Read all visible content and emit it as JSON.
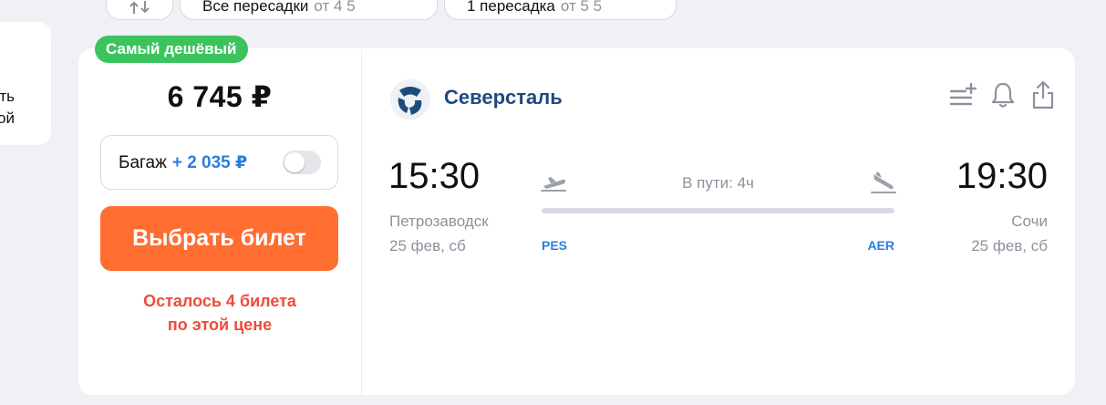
{
  "filters": {
    "sort_icon": "sort-arrows-icon",
    "all_transfers": {
      "label": "Все пересадки",
      "price": "от 4 5"
    },
    "one_transfer": {
      "label": "1 пересадка",
      "price": "от 5 5"
    }
  },
  "side_card": {
    "line1": "ть",
    "line2": "ой"
  },
  "ticket": {
    "badge": "Самый дешёвый",
    "price": "6 745 ₽",
    "baggage": {
      "label": "Багаж",
      "extra": "+ 2 035 ₽",
      "enabled": false
    },
    "select_button": "Выбрать билет",
    "remaining": {
      "line1": "Осталось 4 билета",
      "line2": "по этой цене"
    },
    "airline": {
      "name": "Северсталь",
      "logo_color": "#1e4b7e"
    },
    "actions": [
      "add-to-list-icon",
      "bell-icon",
      "share-icon"
    ],
    "departure": {
      "time": "15:30",
      "city": "Петрозаводск",
      "date": "25 фев, сб",
      "iata": "PES"
    },
    "arrival": {
      "time": "19:30",
      "city": "Сочи",
      "date": "25 фев, сб",
      "iata": "AER"
    },
    "duration": "В пути: 4ч"
  },
  "colors": {
    "accent_orange": "#ff6d30",
    "badge_green": "#3cc35d",
    "link_blue": "#2b7de0",
    "warning_red": "#ee4c3a",
    "airline_navy": "#1e4b7e"
  }
}
